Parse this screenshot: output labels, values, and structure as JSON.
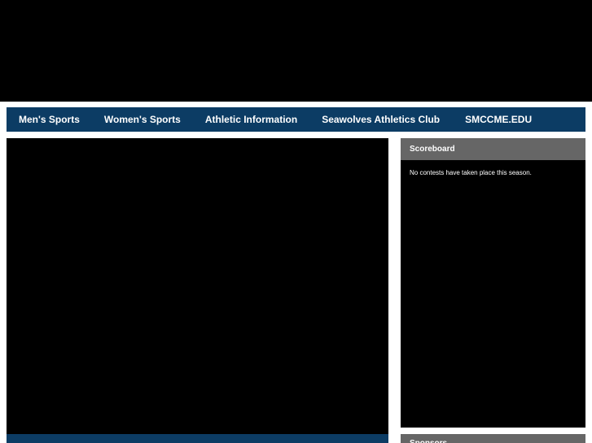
{
  "nav": {
    "items": [
      {
        "label": "Men's Sports"
      },
      {
        "label": "Women's Sports"
      },
      {
        "label": "Athletic Information"
      },
      {
        "label": "Seawolves Athletics Club"
      },
      {
        "label": "SMCCME.EDU"
      }
    ]
  },
  "scoreboard": {
    "title": "Scoreboard",
    "message": "No contests have taken place this season."
  },
  "sponsors": {
    "title": "Sponsors"
  },
  "colors": {
    "nav_bg": "#0c3c64",
    "panel_header": "#666666",
    "background": "#000000"
  }
}
